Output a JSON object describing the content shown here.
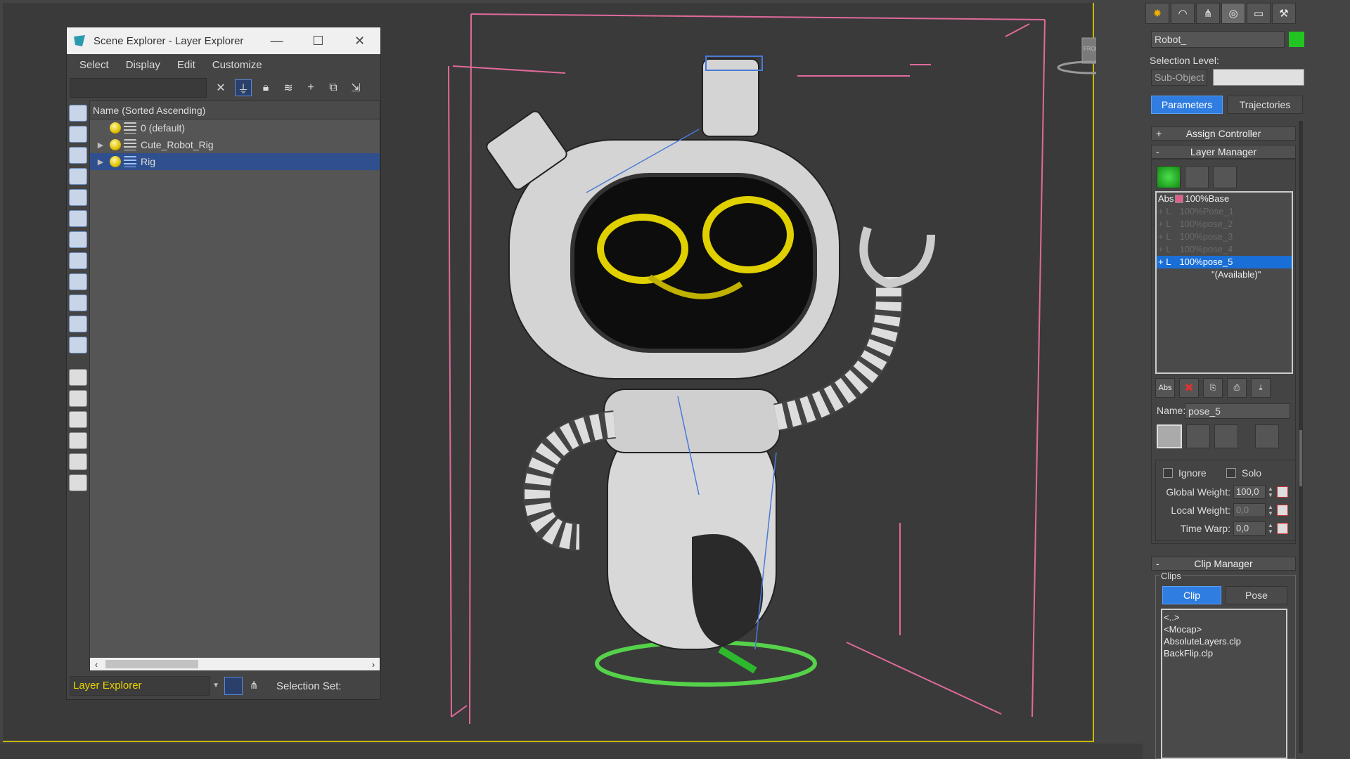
{
  "scene_explorer": {
    "title": "Scene Explorer - Layer Explorer",
    "window_controls": {
      "minimize": "—",
      "maximize": "☐",
      "close": "✕"
    },
    "menu": [
      "Select",
      "Display",
      "Edit",
      "Customize"
    ],
    "search_value": "",
    "column_header": "Name (Sorted Ascending)",
    "layers": [
      {
        "label": "0 (default)",
        "expandable": false,
        "selected": false
      },
      {
        "label": "Cute_Robot_Rig",
        "expandable": true,
        "selected": false
      },
      {
        "label": "Rig",
        "expandable": true,
        "selected": true
      }
    ],
    "explorer_type": "Layer Explorer",
    "selection_set_label": "Selection Set:"
  },
  "command_panel": {
    "object_name": "Robot_",
    "object_color": "#22c422",
    "selection_level_label": "Selection Level:",
    "sub_object_label": "Sub-Object",
    "tabs": {
      "parameters": "Parameters",
      "trajectories": "Trajectories"
    },
    "assign_controller": {
      "sign": "+",
      "label": "Assign Controller"
    },
    "layer_manager": {
      "sign": "-",
      "label": "Layer Manager",
      "layers": [
        {
          "tag": "Abs",
          "weight": "100%",
          "name": "Base",
          "state": "normal"
        },
        {
          "tag": "+ L",
          "weight": "100%",
          "name": "Pose_1",
          "state": "dim"
        },
        {
          "tag": "+ L",
          "weight": "100%",
          "name": "pose_2",
          "state": "dim"
        },
        {
          "tag": "+ L",
          "weight": "100%",
          "name": "pose_3",
          "state": "dim"
        },
        {
          "tag": "+ L",
          "weight": "100%",
          "name": "pose_4",
          "state": "dim"
        },
        {
          "tag": "+ L",
          "weight": "100%",
          "name": "pose_5",
          "state": "selected"
        }
      ],
      "available": "\"(Available)\"",
      "add_abs_label": "Abs",
      "name_label": "Name:",
      "name_value": "pose_5",
      "ignore_label": "Ignore",
      "solo_label": "Solo",
      "global_weight": {
        "label": "Global Weight:",
        "value": "100,0"
      },
      "local_weight": {
        "label": "Local Weight:",
        "value": "0,0"
      },
      "time_warp": {
        "label": "Time Warp:",
        "value": "0,0"
      }
    },
    "clip_manager": {
      "sign": "-",
      "label": "Clip Manager",
      "group_label": "Clips",
      "clip_btn": "Clip",
      "pose_btn": "Pose",
      "items": [
        "<..>",
        "<Mocap>",
        "AbsoluteLayers.clp",
        "BackFlip.clp"
      ]
    }
  },
  "viewport": {
    "navcube_label": "FRONT",
    "accent_color": "#c8b800"
  }
}
